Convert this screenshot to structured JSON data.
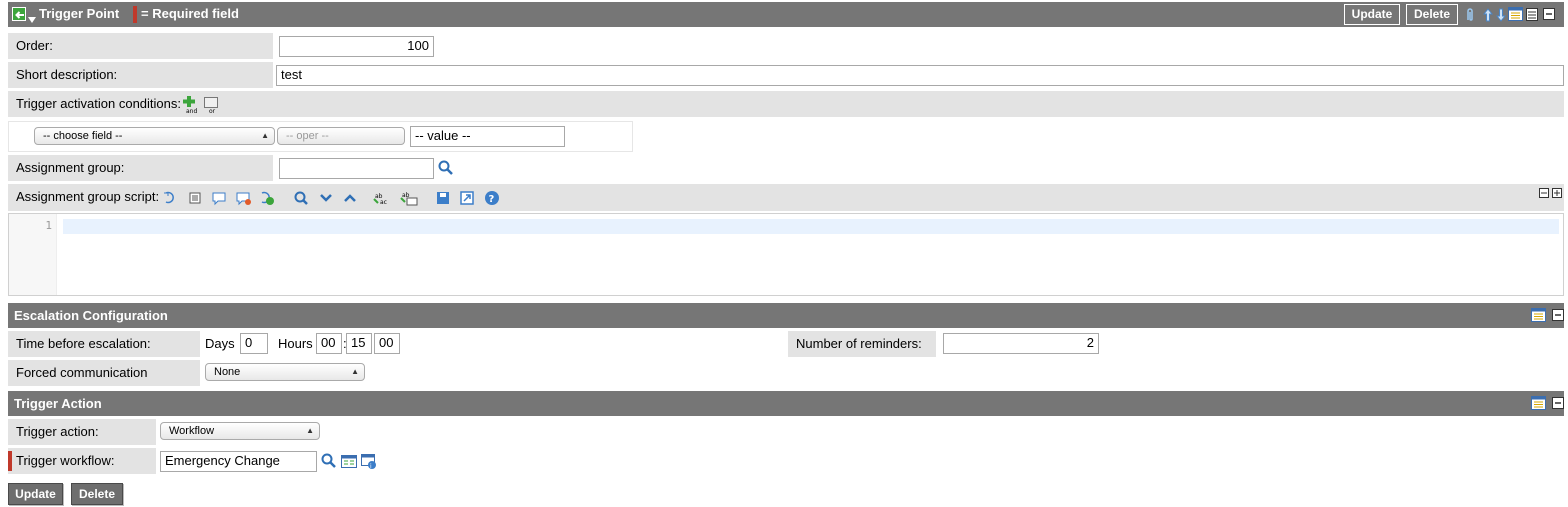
{
  "header": {
    "title": "Trigger Point",
    "required_note": "= Required field",
    "update_label": "Update",
    "delete_label": "Delete"
  },
  "fields": {
    "order_label": "Order:",
    "order_value": "100",
    "short_desc_label": "Short description:",
    "short_desc_value": "test",
    "conditions_label": "Trigger activation conditions:",
    "choose_field": "-- choose field --",
    "oper": "-- oper --",
    "value_placeholder": "-- value --",
    "assign_group_label": "Assignment group:",
    "assign_group_value": "",
    "script_label": "Assignment group script:",
    "line_number": "1"
  },
  "escalation": {
    "title": "Escalation Configuration",
    "time_label": "Time before escalation:",
    "days_label": "Days",
    "days_value": "0",
    "hours_label": "Hours",
    "hh": "00",
    "mm": "15",
    "ss": "00",
    "colon": ":",
    "reminders_label": "Number of reminders:",
    "reminders_value": "2",
    "channel_label": "Forced communication channel:",
    "channel_value": "None"
  },
  "action": {
    "title": "Trigger Action",
    "action_label": "Trigger action:",
    "action_value": "Workflow",
    "workflow_label": "Trigger workflow:",
    "workflow_value": "Emergency Change"
  },
  "footer": {
    "update_label": "Update",
    "delete_label": "Delete"
  },
  "colors": {
    "header_bg": "#767676",
    "label_bg": "#e3e3e3",
    "required_marker": "#c0392b"
  }
}
